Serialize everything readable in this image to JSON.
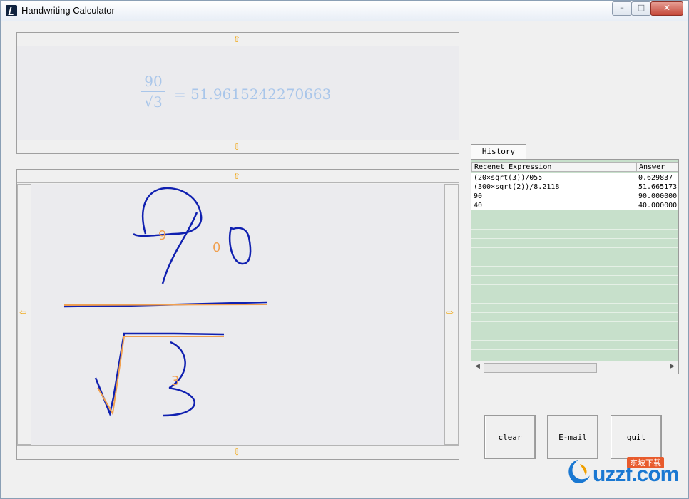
{
  "window": {
    "title": "Handwriting Calculator",
    "controls": {
      "minimize": "–",
      "maximize": "□",
      "close": "✕"
    }
  },
  "result": {
    "numerator": "90",
    "denominator": "√3",
    "answer": "= 51.9615242270663",
    "color": "#a9c6ea"
  },
  "handwriting": {
    "recognized": [
      "9",
      "0",
      "3"
    ],
    "ink_color": "#1020b0",
    "recognized_color": "#f0a050"
  },
  "arrows": {
    "up": "⇧",
    "down": "⇩",
    "left": "⇦",
    "right": "⇨"
  },
  "history": {
    "tab_label": "History",
    "columns": [
      "Recenet Expression",
      "Answer"
    ],
    "rows": [
      {
        "expression": "(20×sqrt(3))/055",
        "answer": "0.629837"
      },
      {
        "expression": "(300×sqrt(2))/8.2118",
        "answer": "51.665173"
      },
      {
        "expression": "90",
        "answer": "90.000000"
      },
      {
        "expression": "40",
        "answer": "40.000000"
      }
    ],
    "row_color": "#c7e0cb"
  },
  "buttons": {
    "clear": "clear",
    "email": "E-mail",
    "quit": "quit"
  },
  "logo": {
    "text": "uzzf.com",
    "badge": "东坡下载"
  }
}
